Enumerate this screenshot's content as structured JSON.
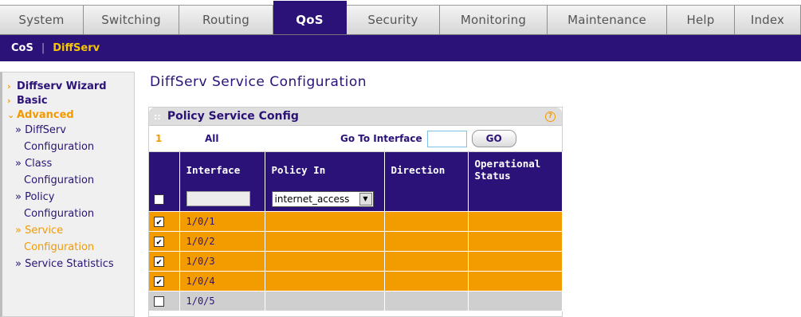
{
  "topnav": {
    "tabs": [
      {
        "label": "System"
      },
      {
        "label": "Switching"
      },
      {
        "label": "Routing"
      },
      {
        "label": "QoS",
        "active": true
      },
      {
        "label": "Security"
      },
      {
        "label": "Monitoring"
      },
      {
        "label": "Maintenance"
      },
      {
        "label": "Help"
      },
      {
        "label": "Index"
      }
    ]
  },
  "subnav": {
    "items": [
      {
        "label": "CoS"
      },
      {
        "label": "DiffServ",
        "active": true
      }
    ],
    "separator": "|"
  },
  "sidebar": {
    "main": [
      {
        "label": "Diffserv Wizard",
        "arrow": "›"
      },
      {
        "label": "Basic",
        "arrow": "›"
      },
      {
        "label": "Advanced",
        "arrow": "⌄"
      }
    ],
    "sub": [
      {
        "line1": "» DiffServ",
        "line2": "Configuration"
      },
      {
        "line1": "» Class",
        "line2": "Configuration"
      },
      {
        "line1": "» Policy",
        "line2": "Configuration"
      },
      {
        "line1": "» Service",
        "line2": "Configuration",
        "active": true
      },
      {
        "line1": "» Service Statistics",
        "line2": ""
      }
    ]
  },
  "page": {
    "title": "DiffServ Service Configuration"
  },
  "panel": {
    "title": "Policy Service Config",
    "pager": {
      "page_number": "1",
      "all_label": "All",
      "goto_label": "Go To Interface",
      "goto_value": "",
      "go_button": "GO"
    },
    "columns": [
      "Interface",
      "Policy In",
      "Direction",
      "Operational Status"
    ],
    "edit_row": {
      "interface_value": "",
      "policy_value": "internet_access"
    },
    "rows": [
      {
        "checked": true,
        "interface": "1/0/1",
        "policy": "",
        "direction": "",
        "status": ""
      },
      {
        "checked": true,
        "interface": "1/0/2",
        "policy": "",
        "direction": "",
        "status": ""
      },
      {
        "checked": true,
        "interface": "1/0/3",
        "policy": "",
        "direction": "",
        "status": ""
      },
      {
        "checked": true,
        "interface": "1/0/4",
        "policy": "",
        "direction": "",
        "status": ""
      },
      {
        "checked": false,
        "interface": "1/0/5",
        "policy": "",
        "direction": "",
        "status": ""
      }
    ]
  },
  "colors": {
    "primary": "#2b1279",
    "accent": "#f39c00",
    "row_checked": "#f39c00",
    "row_unchecked": "#cfcfcf"
  },
  "icons": {
    "help": "help-icon",
    "check": "checkmark-icon",
    "dropdown": "dropdown-arrow-icon"
  }
}
